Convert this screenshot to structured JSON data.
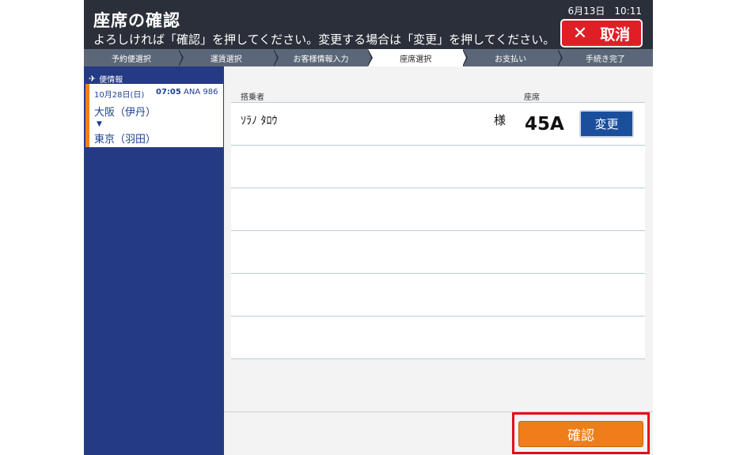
{
  "header": {
    "title": "座席の確認",
    "instruction": "よろしければ「確認」を押してください。変更する場合は「変更」を押してください。",
    "clock": "6月13日　10:11",
    "cancel_label": "取消"
  },
  "steps": [
    {
      "label": "予約便選択",
      "active": false
    },
    {
      "label": "運賃選択",
      "active": false
    },
    {
      "label": "お客様情報入力",
      "active": false
    },
    {
      "label": "座席選択",
      "active": true
    },
    {
      "label": "お支払い",
      "active": false
    },
    {
      "label": "手続き完了",
      "active": false
    }
  ],
  "sidebar": {
    "heading": "便情報",
    "flight": {
      "date": "10月28日(日)",
      "time": "07:05",
      "flight_no": "ANA 986",
      "from": "大阪（伊丹）",
      "to": "東京（羽田）"
    }
  },
  "table": {
    "col_passenger": "搭乗者",
    "col_seat": "座席",
    "passenger_name": "ｿﾗﾉ ﾀﾛｳ",
    "honorific": "様",
    "seat": "45A",
    "change_label": "変更"
  },
  "footer": {
    "confirm_label": "確認"
  },
  "colors": {
    "header_bg": "#2a2f39",
    "cancel_red": "#e01e26",
    "sidebar_blue": "#243a83",
    "accent_orange": "#ef7d19",
    "change_blue": "#1b4f9c",
    "highlight_red": "#e30d1b"
  }
}
